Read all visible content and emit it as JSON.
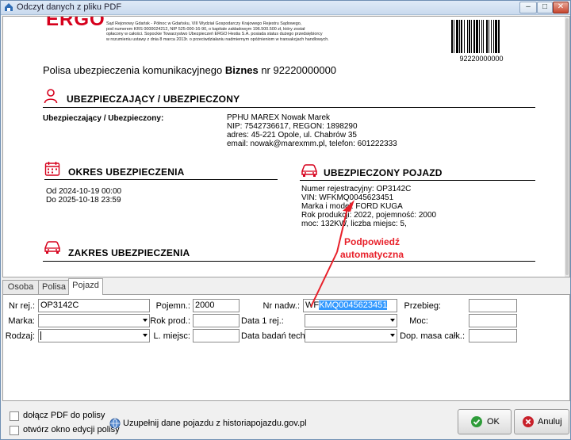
{
  "window": {
    "title": "Odczyt danych z pliku PDF",
    "btn_min": "–",
    "btn_max": "□",
    "btn_close": "✕"
  },
  "colors": {
    "brand_red": "#d6001c",
    "annotation_red": "#e8202a",
    "selection_blue": "#3399ff",
    "ok_green": "#2e9c39",
    "cancel_red": "#c8202a"
  },
  "pdf": {
    "logo": "ERGO",
    "fineprint": [
      "Sąd Rejonowy Gdańsk - Północ w Gdańsku, VIII Wydział Gospodarczy Krajowego Rejestru Sądowego,",
      "pod numerem KRS 0000024212, NIP 525-000-16-90, o kapitale zakładowym 196.500.500 zł, który został",
      "opłacony w całości. Sopockie Towarzystwo Ubezpieczeń ERGO Hestia S.A. posiada status dużego przedsiębiorcy",
      "w rozumieniu ustawy z dnia 8 marca 2013r. o przeciwdziałaniu nadmiernym opóźnieniom w transakcjach handlowych."
    ],
    "barcode_number": "92220000000",
    "policy_title_prefix": "Polisa ubezpieczenia komunikacyjnego ",
    "policy_title_bold": "Biznes",
    "policy_title_suffix": " nr 92220000000",
    "insurer_section": {
      "heading": "UBEZPIECZAJĄCY / UBEZPIECZONY",
      "label": "Ubezpieczający / Ubezpieczony:",
      "lines": [
        "PPHU MAREX Nowak Marek",
        "NIP: 7542736617, REGON: 1898290",
        "adres: 45-221 Opole, ul. Chabrów 35",
        "email: nowak@marexmm.pl, telefon: 601222333"
      ]
    },
    "period_section": {
      "heading": "OKRES UBEZPIECZENIA",
      "from": "Od 2024-10-19 00:00",
      "to": "Do 2025-10-18 23:59"
    },
    "vehicle_section": {
      "heading": "UBEZPIECZONY POJAZD",
      "lines": [
        "Numer rejestracyjny: OP3142C",
        "VIN: WFKMQ0045623451",
        "Marka i model: FORD KUGA",
        "Rok produkcji: 2022, pojemność: 2000",
        "moc: 132KW, liczba miejsc: 5,"
      ]
    },
    "scope_section": {
      "heading": "ZAKRES UBEZPIECZENIA"
    }
  },
  "annotation": {
    "line1": "Podpowiedź",
    "line2": "automatyczna"
  },
  "tabs": [
    {
      "label": "Osoba"
    },
    {
      "label": "Polisa"
    },
    {
      "label": "Pojazd"
    }
  ],
  "form": {
    "nr_rej": {
      "label": "Nr rej.:",
      "value": "OP3142C"
    },
    "marka": {
      "label": "Marka:",
      "value": ""
    },
    "rodzaj": {
      "label": "Rodzaj:",
      "value": ""
    },
    "pojemn": {
      "label": "Pojemn.:",
      "value": "2000"
    },
    "rok_prod": {
      "label": "Rok prod.:",
      "value": ""
    },
    "l_miejsc": {
      "label": "L. miejsc:",
      "value": ""
    },
    "nr_nadw": {
      "label": "Nr nadw.:",
      "value_plain": "WF",
      "value_selected": "KMQ0045623451"
    },
    "data_1_rej": {
      "label": "Data 1 rej.:",
      "value": ""
    },
    "data_badan": {
      "label": "Data badań tech.:",
      "value": ""
    },
    "przebieg": {
      "label": "Przebieg:",
      "value": ""
    },
    "moc": {
      "label": "Moc:",
      "value": ""
    },
    "dop_masa": {
      "label": "Dop. masa całk.:",
      "value": ""
    }
  },
  "bottom": {
    "attach_pdf": {
      "label": "dołącz PDF do polisy",
      "checked": false
    },
    "open_editor": {
      "label": "otwórz okno edycji polisy",
      "checked": false
    },
    "fill_link": "Uzupełnij dane pojazdu z historiapojazdu.gov.pl",
    "ok": "OK",
    "cancel": "Anuluj"
  }
}
